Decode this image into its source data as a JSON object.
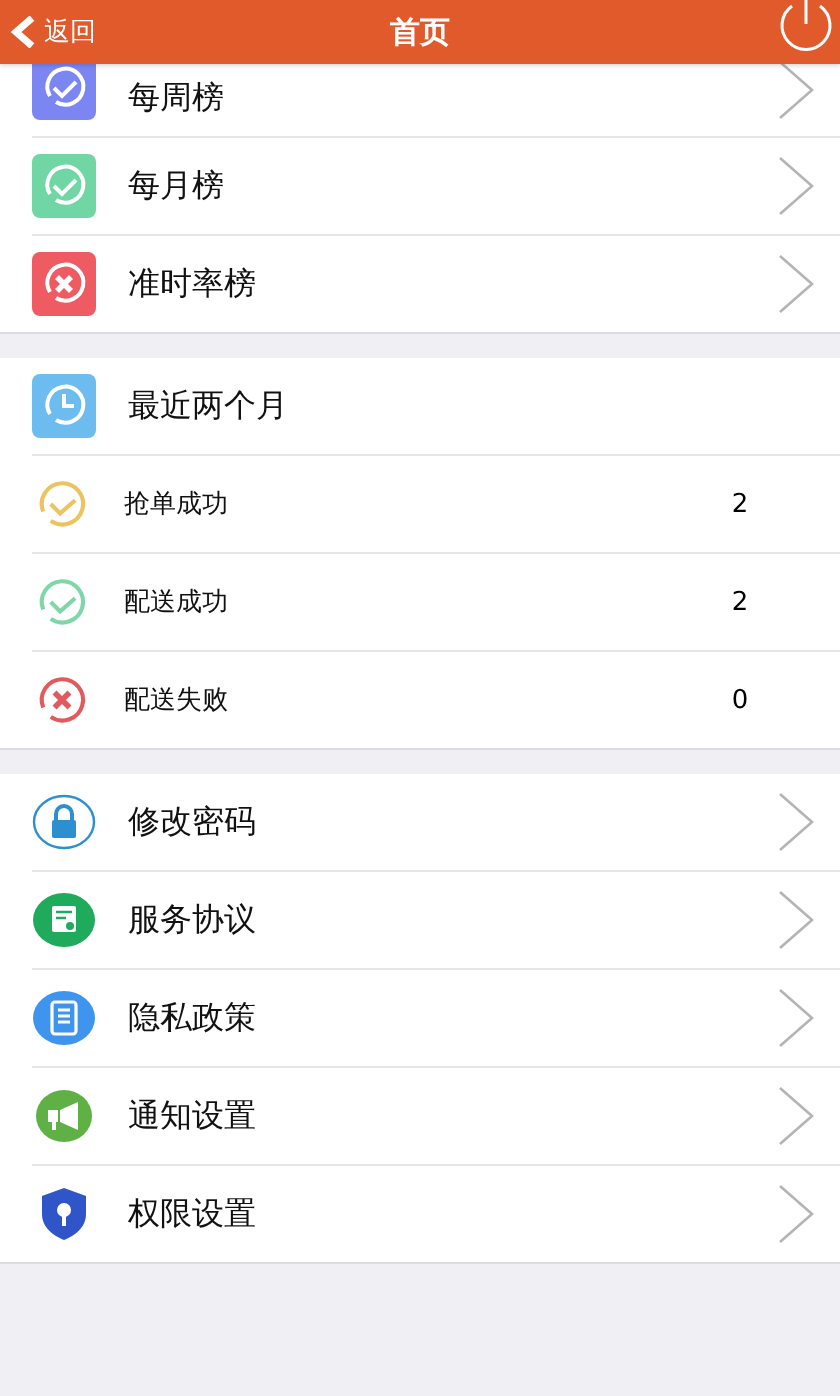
{
  "header": {
    "back_label": "返回",
    "title": "首页"
  },
  "rankings": [
    {
      "label": "每周榜"
    },
    {
      "label": "每月榜"
    },
    {
      "label": "准时率榜"
    }
  ],
  "recent": {
    "title": "最近两个月",
    "stats": [
      {
        "label": "抢单成功",
        "value": "2"
      },
      {
        "label": "配送成功",
        "value": "2"
      },
      {
        "label": "配送失败",
        "value": "0"
      }
    ]
  },
  "settings": [
    {
      "label": "修改密码"
    },
    {
      "label": "服务协议"
    },
    {
      "label": "隐私政策"
    },
    {
      "label": "通知设置"
    },
    {
      "label": "权限设置"
    }
  ]
}
